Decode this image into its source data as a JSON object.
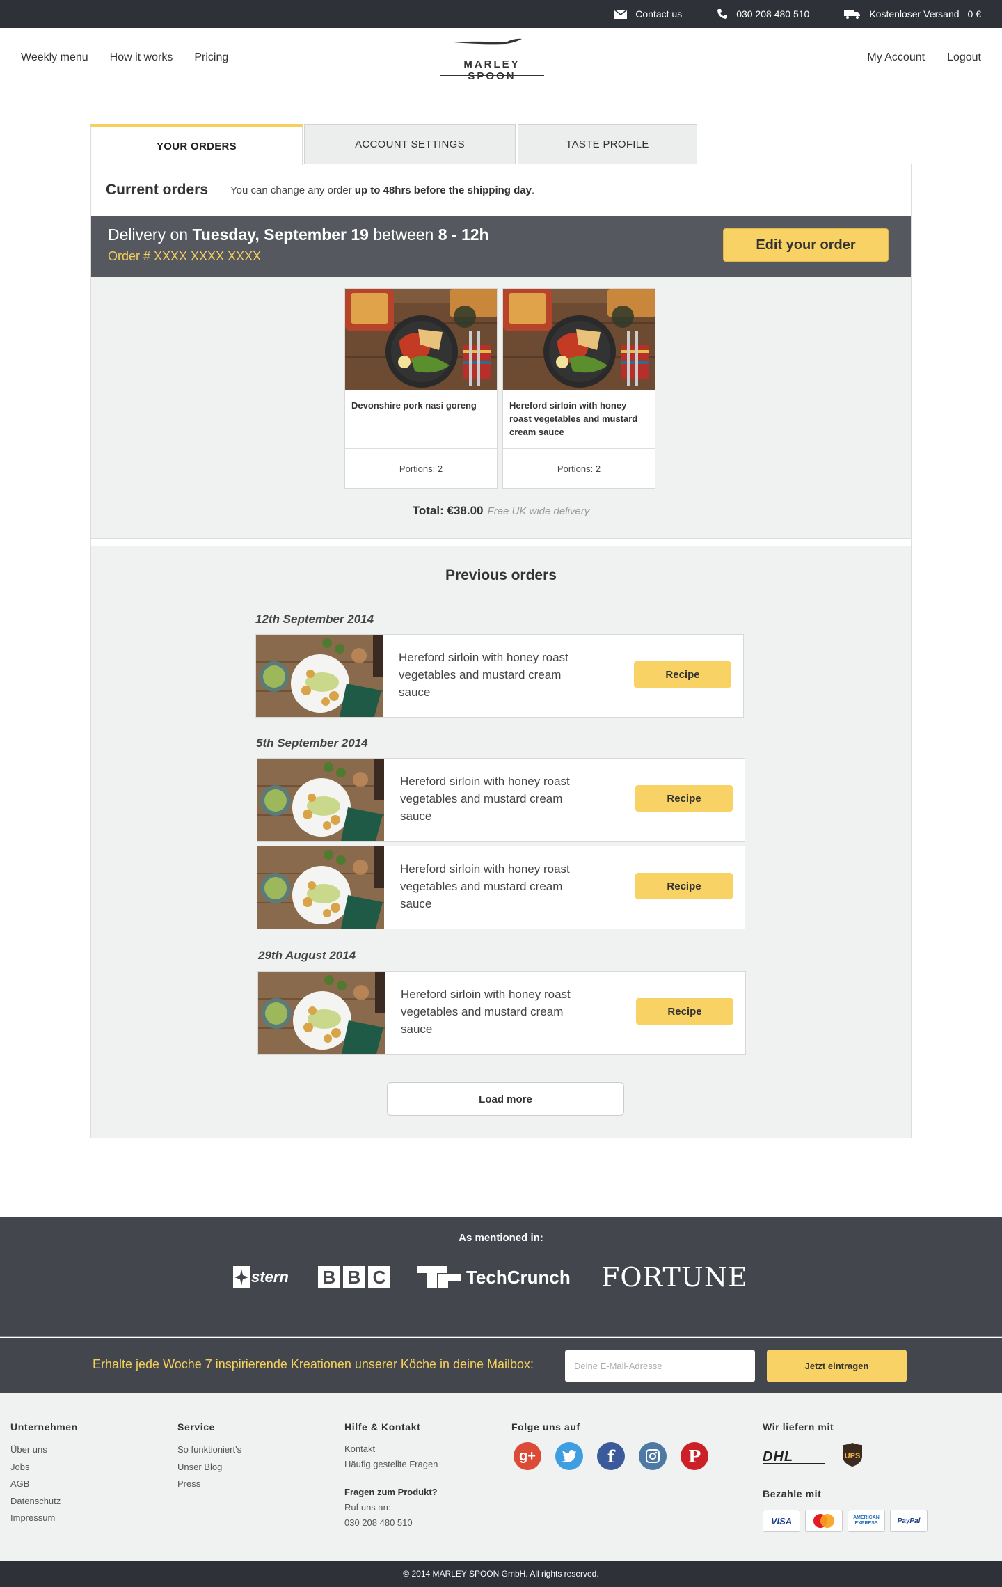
{
  "topbar": {
    "contact": "Contact us",
    "phone": "030 208 480 510",
    "shipping": "Kostenloser Versand",
    "cart_total": "0 €"
  },
  "nav": {
    "weekly_menu": "Weekly menu",
    "how_it_works": "How it works",
    "pricing": "Pricing",
    "logo": "MARLEY SPOON",
    "my_account": "My Account",
    "logout": "Logout"
  },
  "tabs": [
    "YOUR ORDERS",
    "ACCOUNT SETTINGS",
    "TASTE PROFILE"
  ],
  "current": {
    "title": "Current orders",
    "note_prefix": "You can change any order ",
    "note_bold": "up to 48hrs before the shipping day",
    "note_suffix": ".",
    "delivery_prefix": "Delivery on ",
    "delivery_date": "Tuesday, September 19",
    "delivery_mid": " between ",
    "delivery_time": "8 - 12h",
    "order_number": "Order # XXXX XXXX XXXX",
    "edit_button": "Edit your order",
    "items": [
      {
        "name": "Devonshire pork nasi goreng",
        "portions": "Portions: 2"
      },
      {
        "name": "Hereford sirloin with honey roast vegetables and mustard cream sauce",
        "portions": "Portions: 2"
      }
    ],
    "total_label": "Total: €38.00",
    "delivery_note": "Free UK wide delivery"
  },
  "previous": {
    "title": "Previous orders",
    "groups": [
      {
        "date": "12th September 2014",
        "items": [
          {
            "name": "Hereford sirloin with honey roast vegetables and mustard cream sauce",
            "button": "Recipe"
          }
        ]
      },
      {
        "date": "5th September 2014",
        "items": [
          {
            "name": "Hereford sirloin with honey roast vegetables and mustard cream sauce",
            "button": "Recipe"
          },
          {
            "name": "Hereford sirloin with honey roast vegetables and mustard cream sauce",
            "button": "Recipe"
          }
        ]
      },
      {
        "date": "29th August 2014",
        "items": [
          {
            "name": "Hereford sirloin with honey roast vegetables and mustard cream sauce",
            "button": "Recipe"
          }
        ]
      }
    ],
    "load_more": "Load more"
  },
  "mentioned": {
    "heading": "As mentioned in:",
    "logos": [
      "stern",
      "BBC",
      "TechCrunch",
      "FORTUNE"
    ]
  },
  "newsletter": {
    "text": "Erhalte jede Woche 7 inspirierende Kreationen unserer Köche in deine Mailbox:",
    "placeholder": "Deine E-Mail-Adresse",
    "button": "Jetzt eintragen"
  },
  "footer": {
    "company": {
      "heading": "Unternehmen",
      "links": [
        "Über uns",
        "Jobs",
        "AGB",
        "Datenschutz",
        "Impressum"
      ]
    },
    "service": {
      "heading": "Service",
      "links": [
        "So funktioniert's",
        "Unser Blog",
        "Press"
      ]
    },
    "help": {
      "heading": "Hilfe & Kontakt",
      "links": [
        "Kontakt",
        "Häufig gestellte Fragen"
      ],
      "question": "Fragen zum Produkt?",
      "call": "Ruf uns an:",
      "phone": "030 208 480 510"
    },
    "follow": {
      "heading": "Folge uns auf",
      "networks": [
        "google-plus",
        "twitter",
        "facebook",
        "instagram",
        "pinterest"
      ]
    },
    "delivery": {
      "heading": "Wir liefern mit",
      "carriers": [
        "DHL",
        "UPS"
      ]
    },
    "payment": {
      "heading": "Bezahle mit",
      "methods": [
        "VISA",
        "MasterCard",
        "AMERICAN EXPRESS",
        "PayPal"
      ]
    }
  },
  "copyright": "© 2014 MARLEY SPOON GmbH. All rights reserved.",
  "colors": {
    "accent": "#f8d264",
    "dark": "#2e3138",
    "banner": "#55585f",
    "panel_bg": "#f0f2f1"
  }
}
